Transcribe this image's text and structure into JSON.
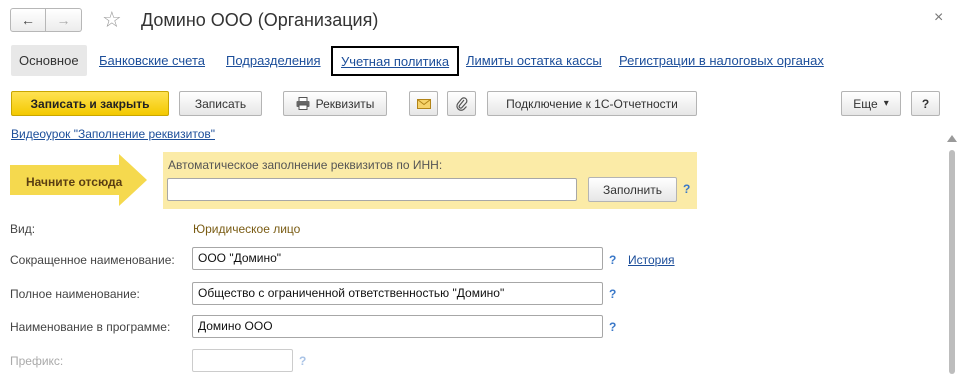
{
  "window": {
    "title": "Домино ООО (Организация)",
    "close_glyph": "×"
  },
  "nav": {
    "back_glyph": "←",
    "forward_glyph": "→",
    "favorite_glyph": "☆"
  },
  "tabs": [
    {
      "label": "Основное"
    },
    {
      "label": "Банковские счета"
    },
    {
      "label": "Подразделения"
    },
    {
      "label": "Учетная политика"
    },
    {
      "label": "Лимиты остатка кассы"
    },
    {
      "label": "Регистрации в налоговых органах"
    }
  ],
  "toolbar": {
    "save_close": "Записать и закрыть",
    "save": "Записать",
    "requisites": "Реквизиты",
    "connect": "Подключение к 1С-Отчетности",
    "more": "Еще",
    "more_arrow": "▾",
    "help": "?"
  },
  "video_link": "Видеоурок \"Заполнение реквизитов\"",
  "banner": {
    "start_here": "Начните отсюда",
    "autofill_label": "Автоматическое заполнение реквизитов по ИНН:",
    "inn_value": "",
    "fill_button": "Заполнить",
    "help": "?"
  },
  "form": {
    "kind_label": "Вид:",
    "kind_value": "Юридическое лицо",
    "short_name_label": "Сокращенное наименование:",
    "short_name_value": "ООО \"Домино\"",
    "history_link": "История",
    "full_name_label": "Полное наименование:",
    "full_name_value": "Общество с ограниченной ответственностью \"Домино\"",
    "program_name_label": "Наименование в программе:",
    "program_name_value": "Домино ООО",
    "prefix_label": "Префикс:",
    "help": "?"
  },
  "colors": {
    "primary_button": "#f3c900",
    "banner_bg": "#fbeba7",
    "arrow_bg": "#f5d94e",
    "link": "#1c4e9a",
    "kind_value": "#7a5c14"
  },
  "icons": [
    "back-arrow-icon",
    "forward-arrow-icon",
    "star-icon",
    "close-icon",
    "printer-icon",
    "envelope-icon",
    "paperclip-icon"
  ]
}
